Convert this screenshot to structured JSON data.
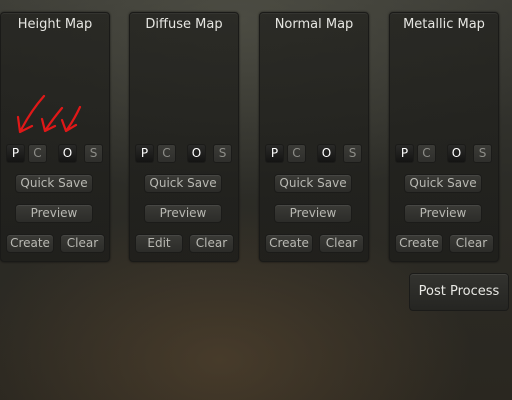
{
  "panels": [
    {
      "title": "Height Map",
      "channels": [
        "P",
        "C",
        "O",
        "S"
      ],
      "channel_states": [
        true,
        false,
        true,
        false
      ],
      "quick_save": "Quick Save",
      "preview": "Preview",
      "left_button": "Create",
      "right_button": "Clear"
    },
    {
      "title": "Diffuse Map",
      "channels": [
        "P",
        "C",
        "O",
        "S"
      ],
      "channel_states": [
        true,
        false,
        true,
        false
      ],
      "quick_save": "Quick Save",
      "preview": "Preview",
      "left_button": "Edit",
      "right_button": "Clear"
    },
    {
      "title": "Normal Map",
      "channels": [
        "P",
        "C",
        "O",
        "S"
      ],
      "channel_states": [
        true,
        false,
        true,
        false
      ],
      "quick_save": "Quick Save",
      "preview": "Preview",
      "left_button": "Create",
      "right_button": "Clear"
    },
    {
      "title": "Metallic Map",
      "channels": [
        "P",
        "C",
        "O",
        "S"
      ],
      "channel_states": [
        true,
        false,
        true,
        false
      ],
      "quick_save": "Quick Save",
      "preview": "Preview",
      "left_button": "Create",
      "right_button": "Clear"
    }
  ],
  "post_process_label": "Post Process",
  "annotation": {
    "shape": "red-arrows",
    "count": 3,
    "color": "#e01818"
  }
}
